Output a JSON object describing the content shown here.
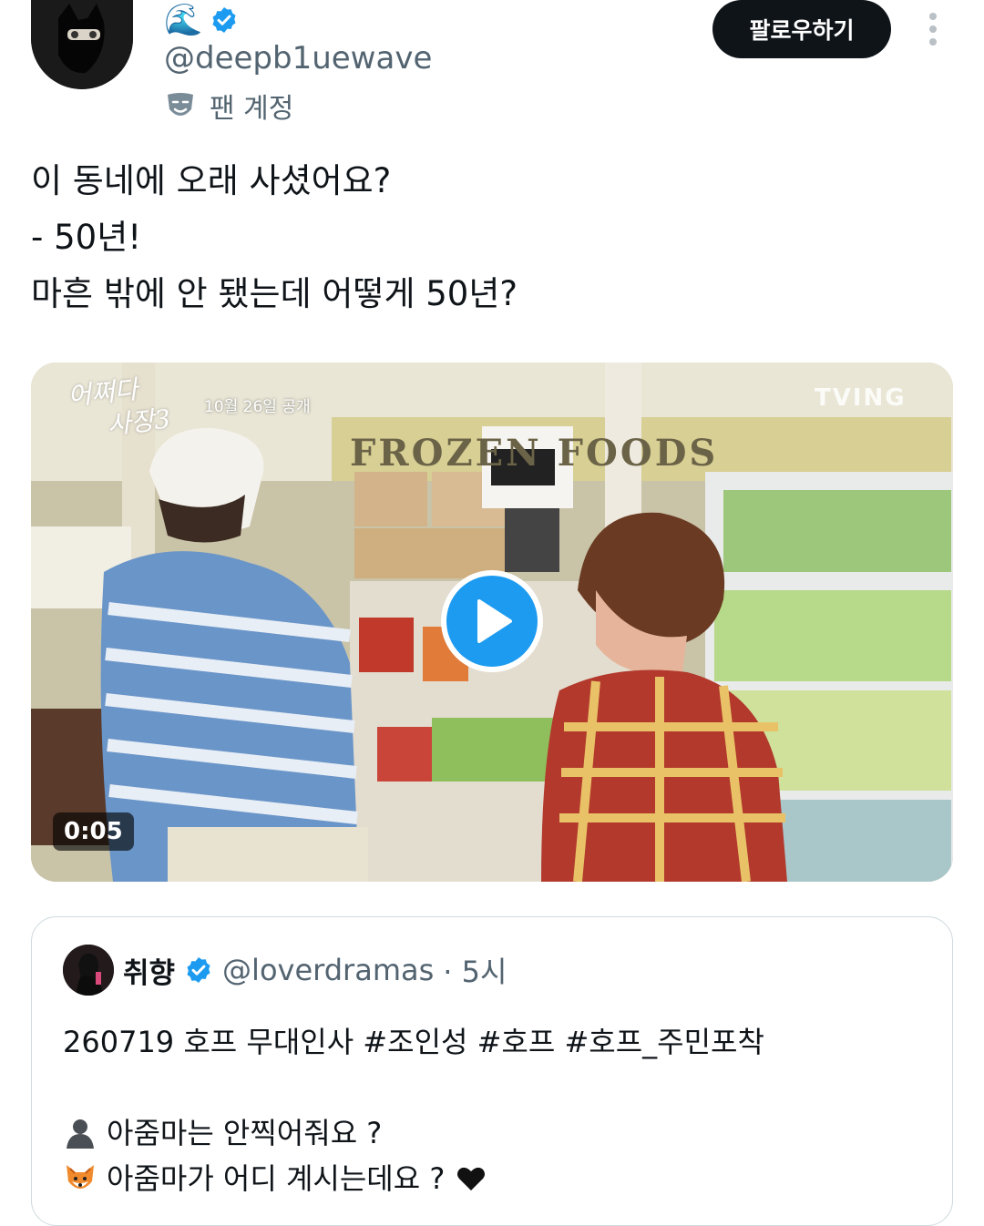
{
  "header": {
    "display_emoji": "🌊",
    "handle": "@deepb1uewave",
    "account_badge_label": "팬 계정",
    "follow_label": "팔로우하기",
    "more_icon": "more-vertical-icon"
  },
  "tweet": {
    "lines": [
      "이 동네에 오래 사셨어요?",
      "- 50년!",
      "마흔 밖에 안 됐는데 어떻게 50년?"
    ]
  },
  "video": {
    "duration": "0:05",
    "overlay_title_line1": "어쩌다",
    "overlay_title_line2": "사장3",
    "overlay_date": "10월 26일 공개",
    "overlay_logo": "TVING",
    "store_sign": "FROZEN FOODS",
    "play_icon": "play-icon"
  },
  "quote": {
    "name": "취향",
    "handle": "@loverdramas",
    "time": "· 5시",
    "lines": [
      "260719 호프 무대인사 #조인성 #호프 #호프_주민포착",
      "",
      "아줌마는 안찍어줘요 ?",
      "아줌마가 어디 계시는데요 ?"
    ],
    "line_icons": [
      "person-silhouette-icon",
      "fox-face-icon",
      "heart-icon"
    ]
  },
  "colors": {
    "accent": "#1d9bf0",
    "text": "#0f1419",
    "secondary": "#536471",
    "border": "#cfd9de"
  }
}
